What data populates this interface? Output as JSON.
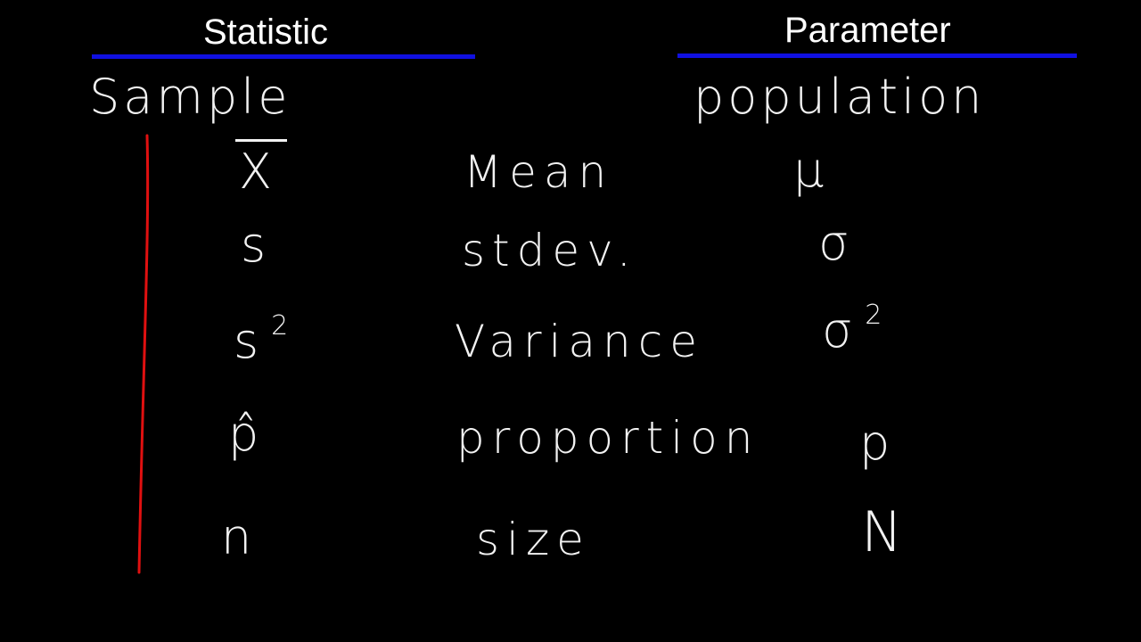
{
  "headers": {
    "statistic": "Statistic",
    "parameter": "Parameter"
  },
  "columns": {
    "sample": "Sample",
    "population": "population"
  },
  "rows": [
    {
      "statistic_symbol": "X",
      "name": "Mean",
      "parameter_symbol": "μ"
    },
    {
      "statistic_symbol": "s",
      "name": "stdev.",
      "parameter_symbol": "σ"
    },
    {
      "statistic_symbol": "s",
      "statistic_exponent": "2",
      "name": "Variance",
      "parameter_symbol": "σ",
      "parameter_exponent": "2"
    },
    {
      "statistic_symbol": "p̂",
      "name": "proportion",
      "parameter_symbol": "p"
    },
    {
      "statistic_symbol": "n",
      "name": "size",
      "parameter_symbol": "N"
    }
  ],
  "colors": {
    "background": "#000000",
    "underline": "#1010e0",
    "bracket": "#e01010",
    "ink": "#f2f2f2"
  }
}
